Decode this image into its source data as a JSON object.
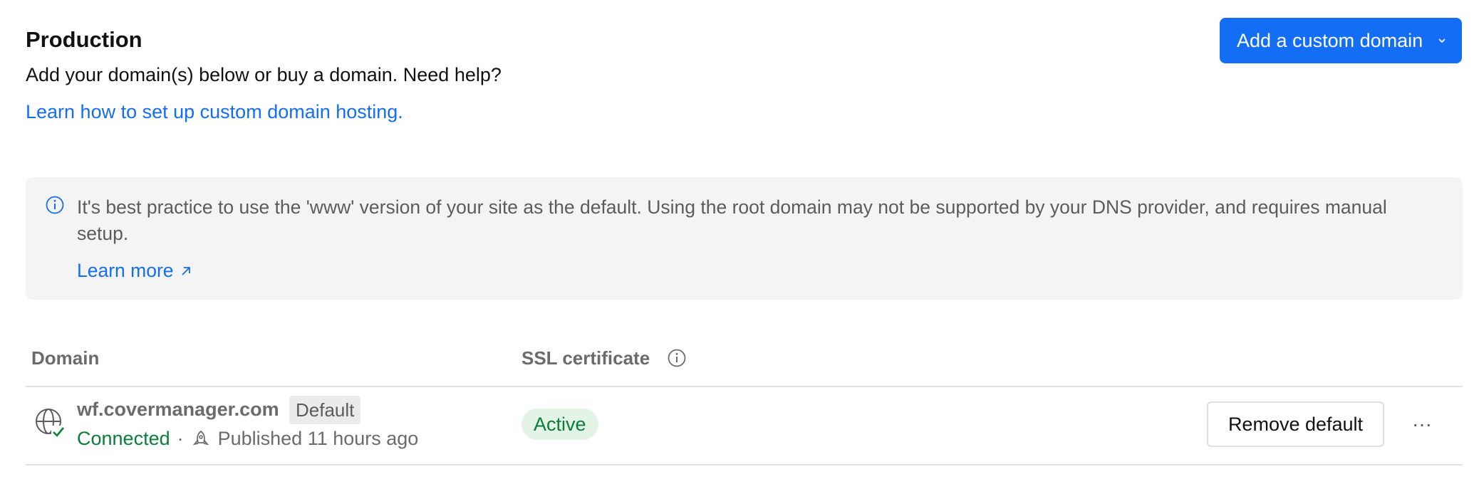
{
  "section": {
    "title": "Production",
    "subtitle": "Add your domain(s) below or buy a domain. Need help?",
    "help_link": "Learn how to set up custom domain hosting.",
    "add_button": "Add a custom domain"
  },
  "callout": {
    "message": "It's best practice to use the 'www' version of your site as the default. Using the root domain may not be supported by your DNS provider, and requires manual setup.",
    "learn_more": "Learn more"
  },
  "table": {
    "headers": {
      "domain": "Domain",
      "ssl": "SSL certificate"
    },
    "rows": [
      {
        "domain": "wf.covermanager.com",
        "badge": "Default",
        "status": "Connected",
        "separator": "·",
        "published": "Published 11 hours ago",
        "ssl_status": "Active",
        "action": "Remove default",
        "more": "···"
      }
    ]
  },
  "colors": {
    "accent": "#146ef5",
    "success": "#0a7d3a",
    "success_bg": "#e3f4e6",
    "callout_bg": "#f4f4f4"
  },
  "icons": [
    "info-icon",
    "arrow-up-right-icon",
    "chevron-down-icon",
    "globe-check-icon",
    "rocket-icon",
    "more-horizontal-icon"
  ]
}
